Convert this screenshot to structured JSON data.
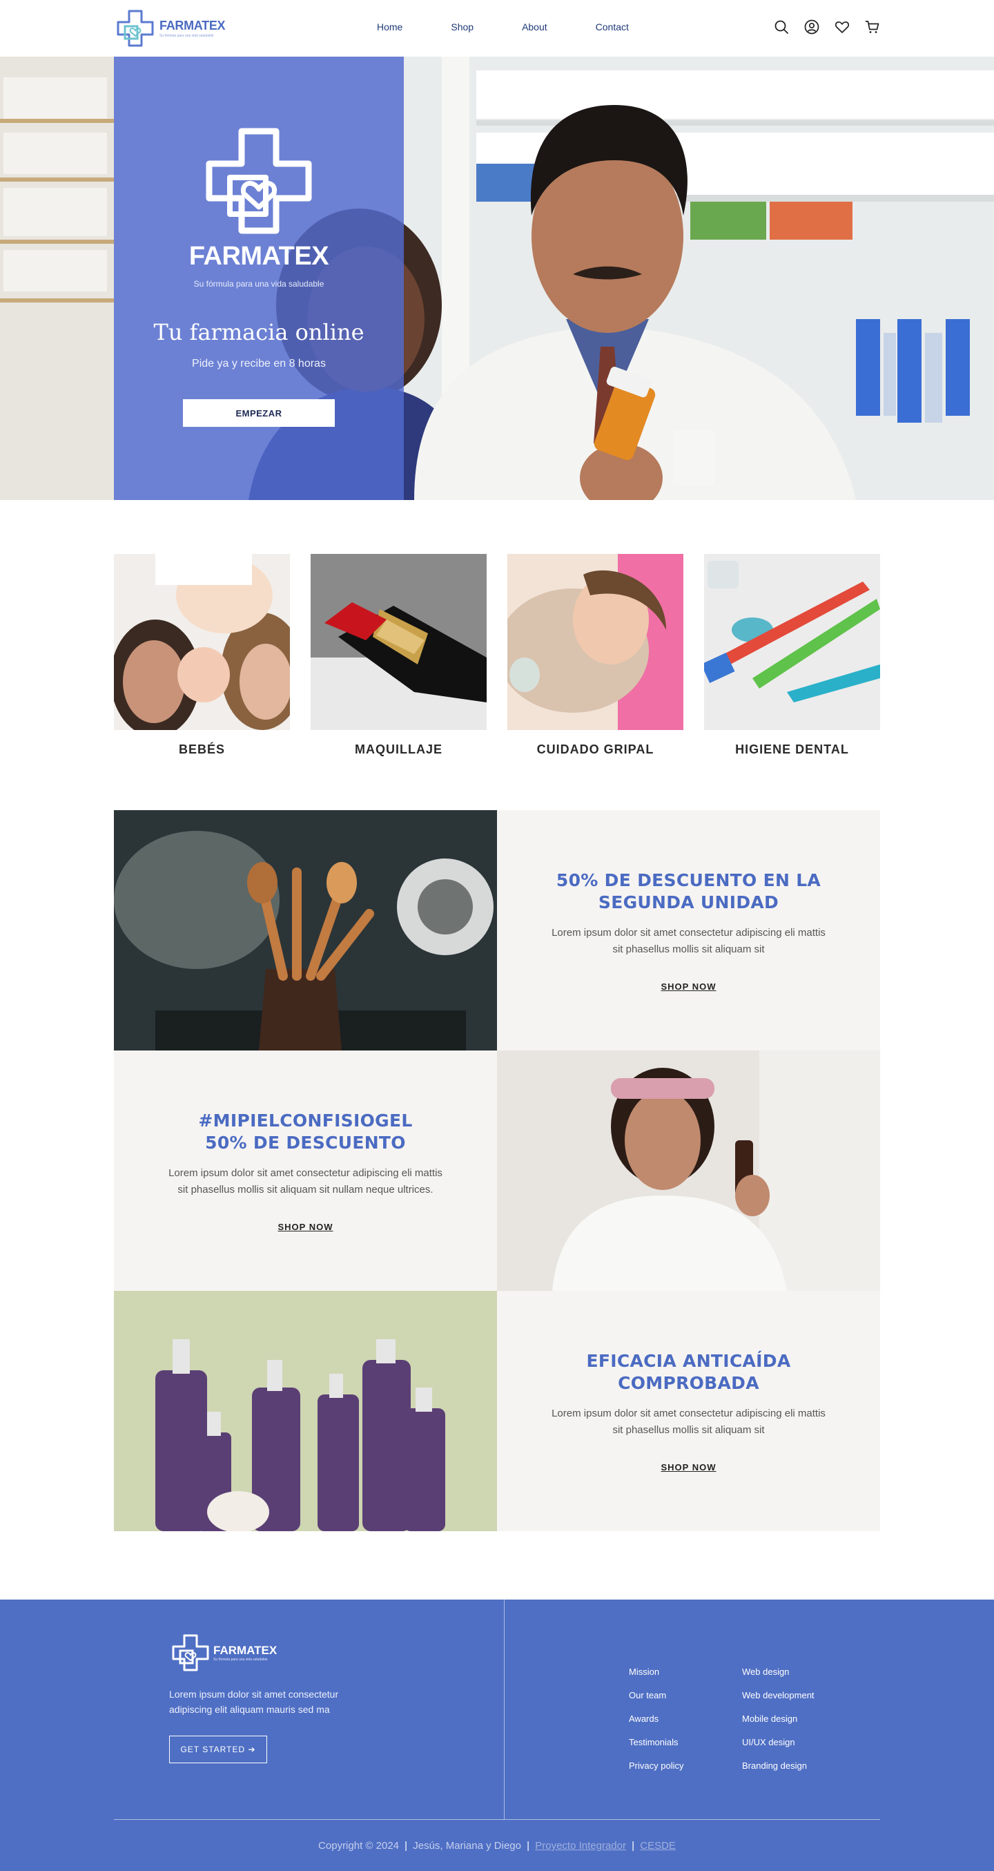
{
  "brand": {
    "name": "FARMATEX",
    "tagline": "Su fórmula para una vida saludable",
    "color": "#4b6bc2"
  },
  "nav": {
    "items": [
      "Home",
      "Shop",
      "About",
      "Contact"
    ]
  },
  "header_icons": [
    "search-icon",
    "user-icon",
    "heart-icon",
    "cart-icon"
  ],
  "hero": {
    "brand": "FARMATEX",
    "tagline": "Su fórmula para una vida saludable",
    "title": "Tu farmacia online",
    "subtitle": "Pide ya y recibe en 8 horas",
    "button": "EMPEZAR"
  },
  "categories": [
    {
      "label": "BEBÉS"
    },
    {
      "label": "MAQUILLAJE"
    },
    {
      "label": "CUIDADO GRIPAL"
    },
    {
      "label": "HIGIENE DENTAL"
    }
  ],
  "promos": [
    {
      "title_line1": "50% DE DESCUENTO EN LA",
      "title_line2": "SEGUNDA UNIDAD",
      "body": "Lorem ipsum dolor sit amet consectetur adipiscing eli mattis sit phasellus mollis sit aliquam sit",
      "link": "SHOP NOW"
    },
    {
      "title_line1": "#MIPIELCONFISIOGEL",
      "title_line2": "50% DE DESCUENTO",
      "body": "Lorem ipsum dolor sit amet consectetur adipiscing eli mattis sit phasellus mollis sit aliquam sit nullam neque ultrices.",
      "link": "SHOP NOW"
    },
    {
      "title_line1": "EFICACIA ANTICAÍDA",
      "title_line2": "COMPROBADA",
      "body": "Lorem ipsum dolor sit amet consectetur adipiscing eli mattis sit phasellus mollis sit aliquam sit",
      "link": "SHOP NOW"
    }
  ],
  "footer": {
    "brand": "FARMATEX",
    "tagline": "Su fórmula para una vida saludable",
    "description": "Lorem ipsum dolor sit amet consectetur adipiscing elit aliquam mauris sed ma",
    "button": "GET STARTED ➔",
    "col1": [
      "Mission",
      "Our team",
      "Awards",
      "Testimonials",
      "Privacy policy"
    ],
    "col2": [
      "Web design",
      "Web development",
      "Mobile design",
      "UI/UX design",
      "Branding design"
    ],
    "copyright": "Copyright © 2024",
    "authors": "Jesús, Mariana y Diego",
    "link1": "Proyecto Integrador",
    "link2": "CESDE",
    "separator": "|"
  }
}
